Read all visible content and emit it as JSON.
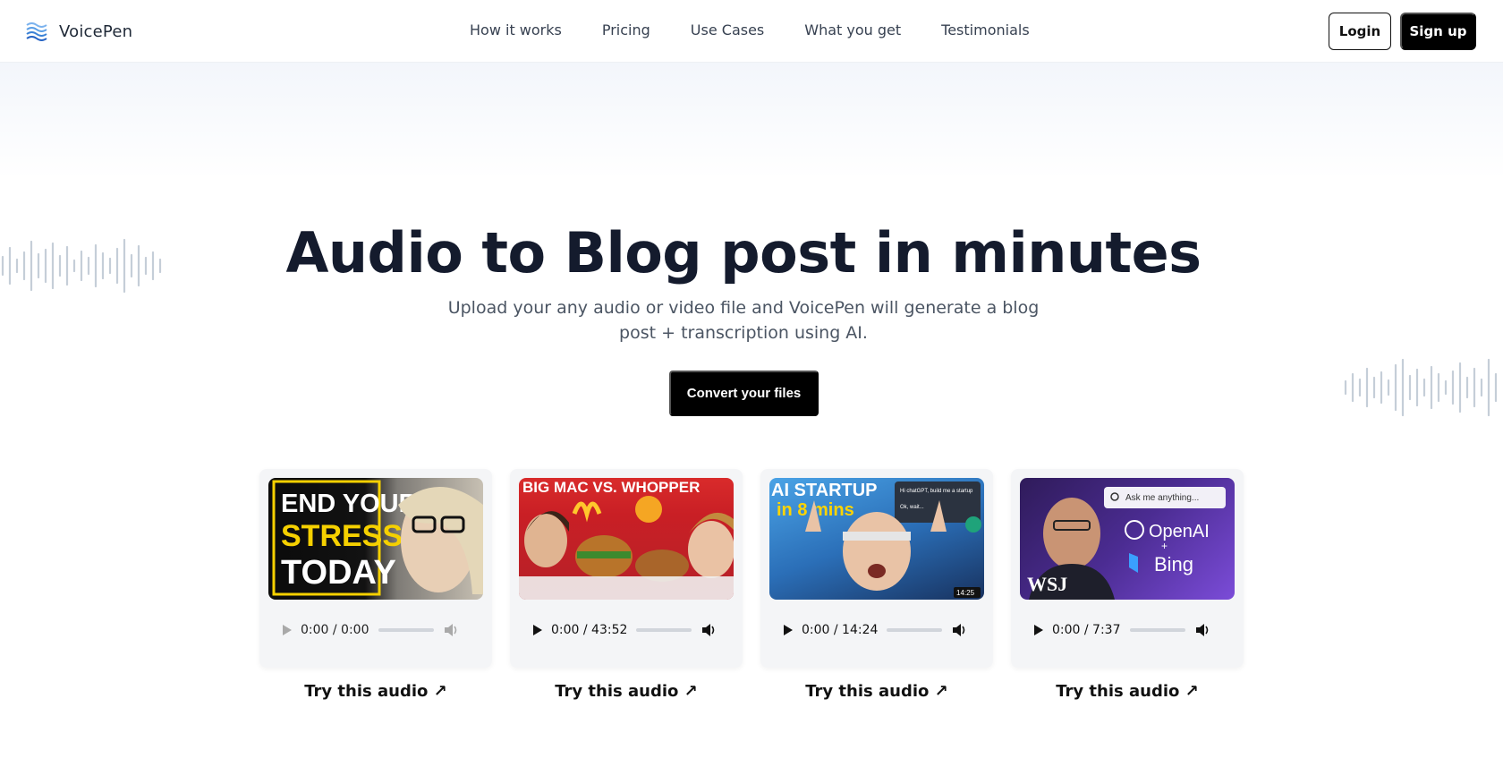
{
  "brand": {
    "name": "VoicePen",
    "logo_icon": "waves-icon",
    "accent": "#60a5fa"
  },
  "nav": {
    "items": [
      "How it works",
      "Pricing",
      "Use Cases",
      "What you get",
      "Testimonials"
    ]
  },
  "auth": {
    "login_label": "Login",
    "signup_label": "Sign up"
  },
  "hero": {
    "title": "Audio to Blog post in minutes",
    "subtitle_line1": "Upload your any audio or video file and VoicePen will generate a blog",
    "subtitle_line2": "post + transcription using AI.",
    "cta_label": "Convert your files"
  },
  "samples": [
    {
      "thumb_lines": [
        "END YOUR",
        "STRESS",
        "TODAY"
      ],
      "time": "0:00 / 0:00",
      "progress": 0,
      "player_enabled": false,
      "link_label": "Try this audio ↗"
    },
    {
      "thumb_lines": [
        "BIG MAC VS. WHOPPER"
      ],
      "time": "0:00 / 43:52",
      "progress": 0,
      "player_enabled": true,
      "link_label": "Try this audio ↗"
    },
    {
      "thumb_lines": [
        "AI STARTUP",
        "in 8 mins"
      ],
      "thumb_chat_lines": [
        "Hi chatGPT, build me a startup",
        "Ok, wait..."
      ],
      "thumb_duration": "14:25",
      "time": "0:00 / 14:24",
      "progress": 0,
      "player_enabled": true,
      "link_label": "Try this audio ↗"
    },
    {
      "thumb_lines": [
        "OpenAI",
        "+",
        "Bing"
      ],
      "thumb_search": "Ask me anything...",
      "thumb_brand": "WSJ",
      "time": "0:00 / 7:37",
      "progress": 0,
      "player_enabled": true,
      "link_label": "Try this audio ↗"
    }
  ]
}
